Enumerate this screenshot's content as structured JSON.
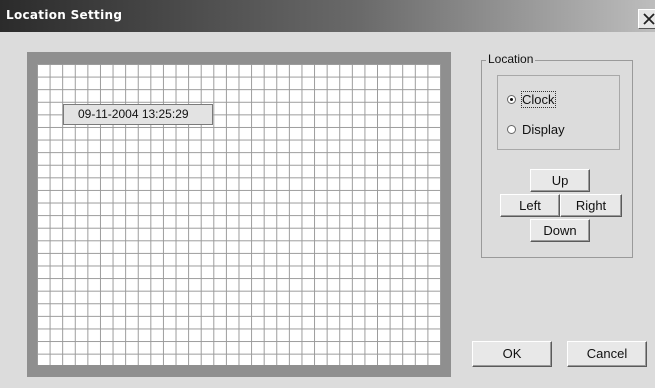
{
  "window": {
    "title": "Location Setting"
  },
  "preview": {
    "clock_text": "09-11-2004 13:25:29"
  },
  "location": {
    "group_label": "Location",
    "options": [
      {
        "label": "Clock",
        "selected": true
      },
      {
        "label": "Display",
        "selected": false
      }
    ],
    "buttons": {
      "up": "Up",
      "left": "Left",
      "right": "Right",
      "down": "Down"
    }
  },
  "footer": {
    "ok": "OK",
    "cancel": "Cancel"
  }
}
